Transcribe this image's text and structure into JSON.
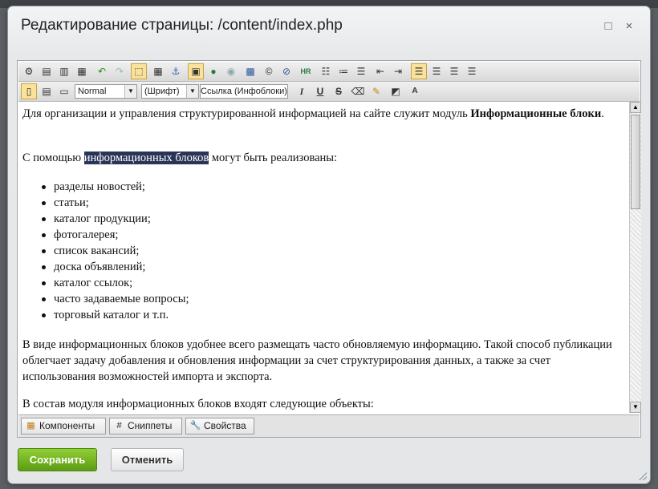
{
  "dialog": {
    "title": "Редактирование страницы: /content/index.php",
    "maximize_icon": "□",
    "close_icon": "×"
  },
  "toolbar": {
    "style_select": "Normal",
    "font_select": "(Шрифт)",
    "link_select": "Ссылка (Инфоблоки)",
    "row1_icons": [
      "settings-icon",
      "paste-word-icon",
      "paste-text-icon",
      "paste-icon",
      "undo-icon",
      "redo-icon",
      "borders-icon",
      "table-icon",
      "anchor-icon",
      "special-icon",
      "flash-icon",
      "media-icon",
      "image-icon",
      "copyright-icon",
      "link-icon",
      "hr-icon",
      "ordered-list-icon",
      "numbered-list-icon",
      "bullet-list-icon",
      "outdent-icon",
      "indent-icon",
      "align-left-icon",
      "align-center-icon",
      "align-right-icon",
      "justify-icon"
    ],
    "row2_icons": [
      "wysiwyg-mode-icon",
      "code-mode-icon",
      "split-mode-icon",
      "italic-icon",
      "underline-icon",
      "strike-icon",
      "eraser-icon",
      "clean-icon",
      "text-color-icon",
      "bg-color-icon"
    ]
  },
  "content": {
    "p1_text": "Для организации и управления структурированной информацией на сайте служит модуль ",
    "p1_bold": "Информационные блоки",
    "p1_end": ".",
    "p2_before": "С помощью ",
    "p2_highlight": "информационных блоков",
    "p2_after": " могут быть реализованы:",
    "list": [
      "разделы новостей;",
      "статьи;",
      "каталог продукции;",
      "фотогалерея;",
      "список вакансий;",
      "доска объявлений;",
      "каталог ссылок;",
      "часто задаваемые вопросы;",
      "торговый каталог и т.п."
    ],
    "p3": "В виде информационных блоков удобнее всего размещать часто обновляемую информацию. Такой способ публикации облегчает задачу добавления и обновления информации за счет структурирования данных, а также за счет использования возможностей импорта и экспорта.",
    "p4": "В состав модуля информационных блоков входят следующие объекты:"
  },
  "tabs": {
    "components": "Компоненты",
    "snippets": "Сниппеты",
    "properties": "Свойства"
  },
  "buttons": {
    "save": "Сохранить",
    "cancel": "Отменить"
  },
  "colors": {
    "accent_green": "#6aae1b",
    "selection": "#293457"
  }
}
